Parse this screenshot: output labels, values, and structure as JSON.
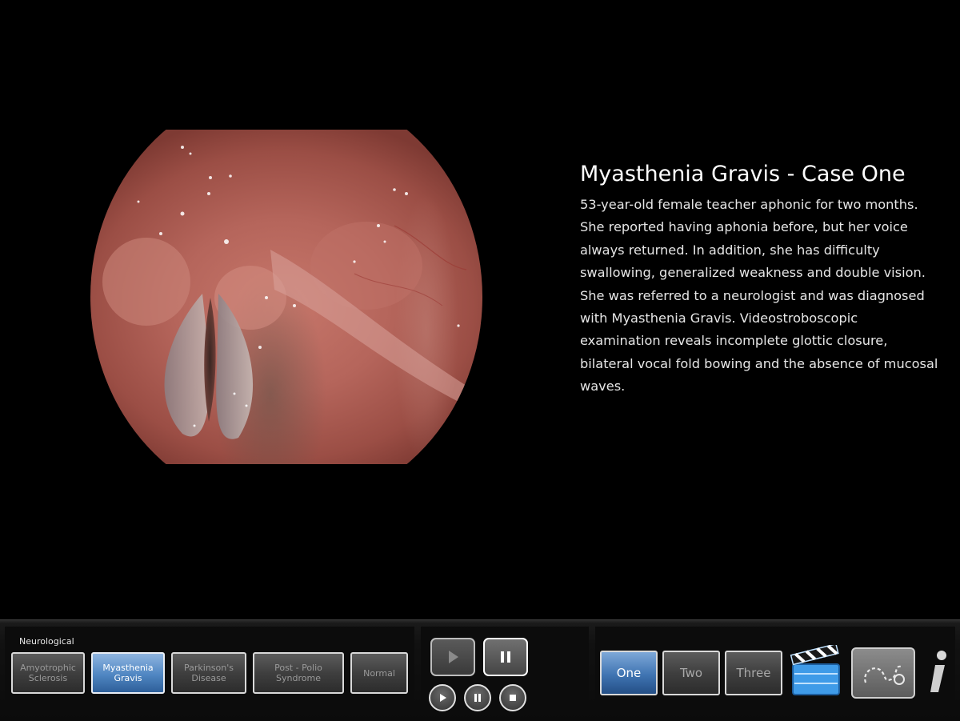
{
  "case": {
    "title": "Myasthenia Gravis - Case One",
    "description": "53-year-old female teacher aphonic for two months. She reported having aphonia before, but her voice always returned. In addition, she has difficulty swallowing, generalized weakness and double vision. She was referred to a neurologist and was diagnosed with Myasthenia Gravis. Videostroboscopic examination reveals incomplete glottic closure, bilateral vocal fold bowing and the absence of mucosal waves."
  },
  "toolbar": {
    "category_label": "Neurological",
    "categories": [
      {
        "label": "Amyotrophic\nSclerosis",
        "active": false
      },
      {
        "label": "Myasthenia\nGravis",
        "active": true
      },
      {
        "label": "Parkinson's\nDisease",
        "active": false
      },
      {
        "label": "Post - Polio\nSyndrome",
        "active": false
      },
      {
        "label": "Normal",
        "active": false
      }
    ],
    "cases": [
      {
        "label": "One",
        "active": true
      },
      {
        "label": "Two",
        "active": false
      },
      {
        "label": "Three",
        "active": false
      }
    ],
    "playback": {
      "large": [
        "play-icon",
        "pause-icon"
      ],
      "small": [
        "play-icon",
        "pause-icon",
        "stop-icon"
      ]
    },
    "icons": [
      "clapperboard-icon",
      "drawing-icon",
      "info-icon"
    ]
  }
}
